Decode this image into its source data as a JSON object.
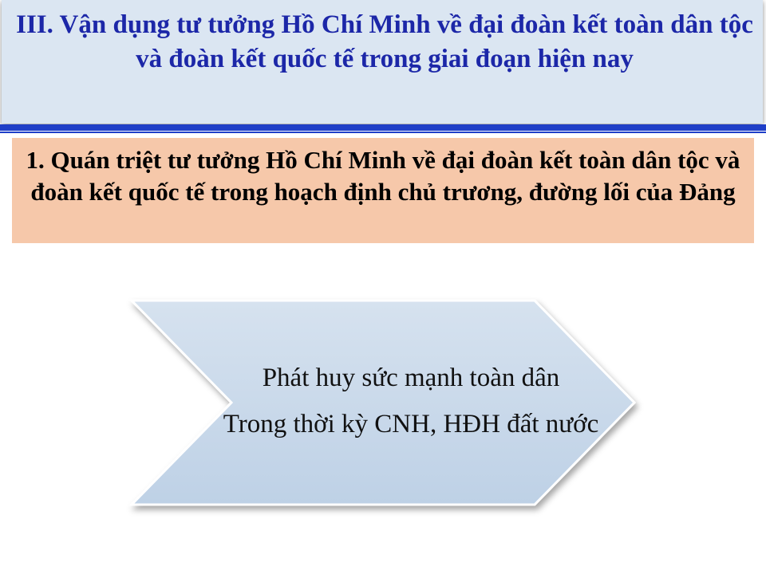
{
  "slide": {
    "title": "III. Vận dụng tư tưởng Hồ Chí Minh về đại đoàn kết toàn dân tộc và đoàn kết quốc tế trong giai đoạn hiện nay",
    "subtitle": "1. Quán triệt tư tưởng Hồ Chí Minh về đại đoàn kết toàn dân tộc và đoàn kết quốc tế trong hoạch định chủ trương, đường lối của Đảng",
    "chevron": {
      "line1": "Phát huy sức mạnh toàn dân",
      "line2": "Trong thời kỳ CNH, HĐH đất nước"
    }
  },
  "colors": {
    "title_background": "#dbe6f2",
    "title_text": "#1c27a8",
    "rule": "#1f3fc8",
    "subtitle_background": "#f6c8aa",
    "chevron_fill_top": "#d3dfed",
    "chevron_fill_bottom": "#bcd0e6"
  }
}
